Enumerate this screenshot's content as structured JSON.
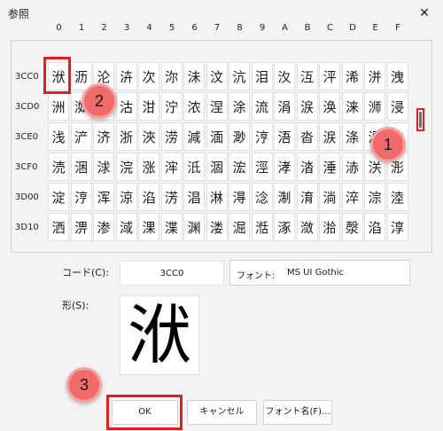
{
  "window": {
    "title": "参照",
    "close_glyph": "✕"
  },
  "grid": {
    "columns": [
      "0",
      "1",
      "2",
      "3",
      "4",
      "5",
      "6",
      "7",
      "8",
      "9",
      "A",
      "B",
      "C",
      "D",
      "E",
      "F"
    ],
    "rows": [
      {
        "label": "3CC0",
        "chars": [
          "洑",
          "沥",
          "沦",
          "泋",
          "次",
          "沵",
          "沬",
          "汶",
          "沆",
          "泪",
          "汷",
          "沍",
          "泙",
          "浠",
          "洴",
          "洩"
        ]
      },
      {
        "label": "3CD0",
        "chars": [
          "洲",
          "洳",
          "洴",
          "沽",
          "泔",
          "泞",
          "浓",
          "涅",
          "涂",
          "流",
          "涓",
          "涙",
          "涣",
          "涞",
          "浉",
          "浸"
        ]
      },
      {
        "label": "3CE0",
        "chars": [
          "浅",
          "浐",
          "济",
          "浙",
          "浹",
          "涝",
          "減",
          "湎",
          "渺",
          "涥",
          "浯",
          "沓",
          "涙",
          "涤",
          "涩",
          "洙"
        ]
      },
      {
        "label": "3CF0",
        "chars": [
          "涜",
          "涃",
          "浗",
          "浣",
          "涨",
          "浶",
          "泜",
          "涸",
          "浤",
          "涇",
          "涍",
          "涾",
          "涶",
          "浾",
          "浂",
          "浵"
        ]
      },
      {
        "label": "3D00",
        "chars": [
          "淀",
          "涥",
          "浑",
          "涼",
          "淊",
          "淓",
          "淐",
          "淋",
          "淂",
          "淰",
          "淛",
          "淯",
          "淌",
          "淬",
          "淙",
          "淕"
        ]
      },
      {
        "label": "3D10",
        "chars": [
          "洒",
          "淠",
          "渗",
          "淢",
          "淉",
          "渫",
          "渊",
          "溇",
          "淈",
          "湉",
          "涿",
          "潋",
          "湁",
          "漀",
          "淊",
          "淳"
        ]
      }
    ]
  },
  "code": {
    "label": "コード(C):",
    "value": "3CC0"
  },
  "font": {
    "label": "フォント:",
    "value": "MS UI Gothic"
  },
  "shape": {
    "label": "形(S):",
    "char": "洑"
  },
  "buttons": {
    "ok": "OK",
    "cancel": "キャンセル",
    "font_name": "フォント名(F)..."
  },
  "annotations": {
    "scroll_marker": "1",
    "selected_marker": "2",
    "ok_marker": "3"
  },
  "colors": {
    "highlight": "#e02020",
    "badge": "#f16a6a"
  }
}
